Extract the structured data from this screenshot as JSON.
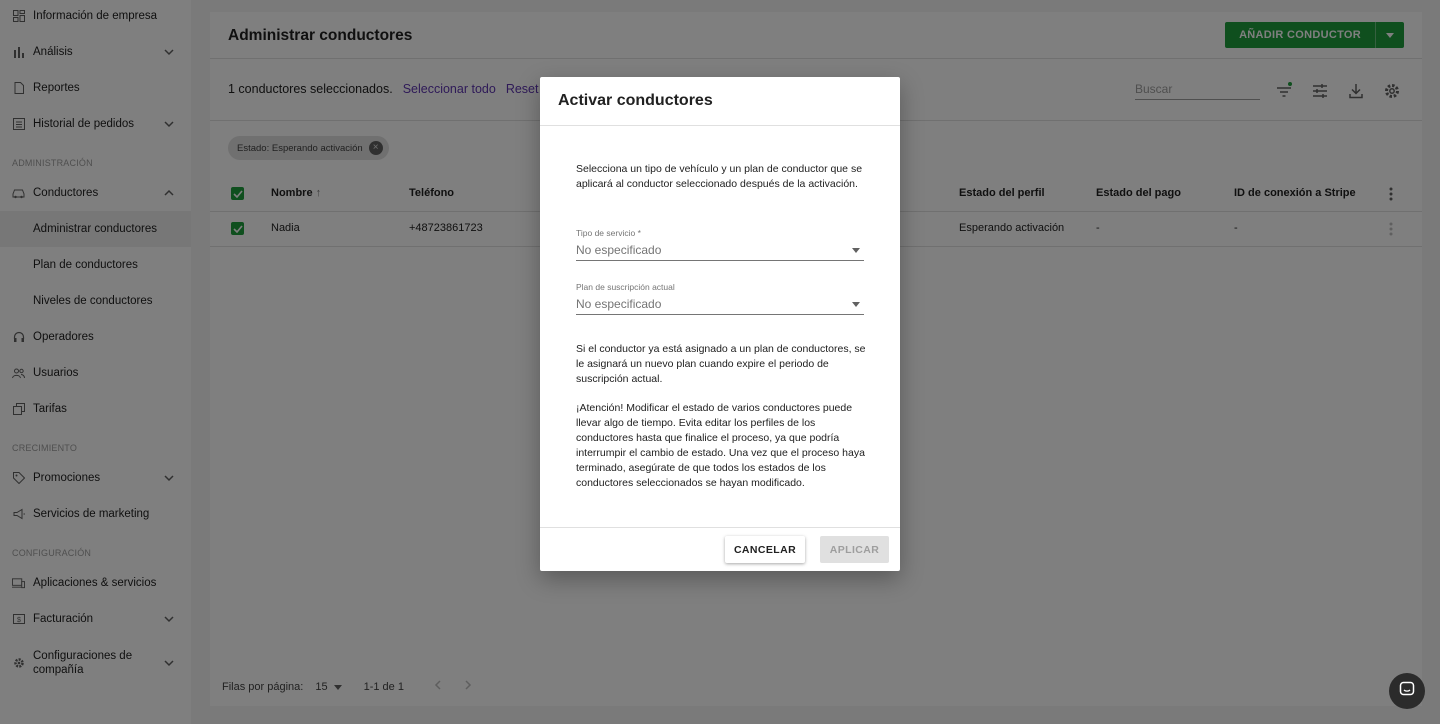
{
  "sidebar": {
    "items": [
      {
        "label": "Información de empresa"
      },
      {
        "label": "Análisis"
      },
      {
        "label": "Reportes"
      },
      {
        "label": "Historial de pedidos"
      },
      {
        "label": "Conductores"
      },
      {
        "label": "Administrar conductores"
      },
      {
        "label": "Plan de conductores"
      },
      {
        "label": "Niveles de conductores"
      },
      {
        "label": "Operadores"
      },
      {
        "label": "Usuarios"
      },
      {
        "label": "Tarifas"
      },
      {
        "label": "Promociones"
      },
      {
        "label": "Servicios de marketing"
      },
      {
        "label": "Aplicaciones & servicios"
      },
      {
        "label": "Facturación"
      },
      {
        "label": "Configuraciones de compañía"
      }
    ],
    "sections": {
      "admin": "ADMINISTRACIÓN",
      "growth": "CRECIMIENTO",
      "config": "CONFIGURACIÓN"
    }
  },
  "main": {
    "title": "Administrar conductores",
    "add_button": "AÑADIR CONDUCTOR",
    "selection_text": "1 conductores seleccionados.",
    "select_all": "Seleccionar todo",
    "reset": "Reset",
    "search_placeholder": "Buscar",
    "filter_chip": "Estado: Esperando activación",
    "columns": {
      "name": "Nombre",
      "phone": "Teléfono",
      "profile_status": "Estado del perfil",
      "payment_status": "Estado del pago",
      "stripe_id": "ID de conexión a Stripe"
    },
    "rows": [
      {
        "name": "Nadia",
        "phone": "+48723861723",
        "profile_status": "Esperando activación",
        "payment_status": "-",
        "stripe_id": "-"
      }
    ],
    "footer": {
      "rows_per_page_label": "Filas por página:",
      "rows_per_page": "15",
      "range": "1-1 de 1"
    }
  },
  "dialog": {
    "title": "Activar conductores",
    "intro": "Selecciona un tipo de vehículo y un plan de conductor que se aplicará al conductor seleccionado después de la activación.",
    "service_type_label": "Tipo de servicio *",
    "service_type_value": "No especificado",
    "plan_label": "Plan de suscripción actual",
    "plan_value": "No especificado",
    "note1": "Si el conductor ya está asignado a un plan de conductores, se le asignará un nuevo plan cuando expire el periodo de suscripción actual.",
    "note2": "¡Atención! Modificar el estado de varios conductores puede llevar algo de tiempo. Evita editar los perfiles de los conductores hasta que finalice el proceso, ya que podría interrumpir el cambio de estado. Una vez que el proceso haya terminado, asegúrate de que todos los estados de los conductores seleccionados se hayan modificado.",
    "cancel": "CANCELAR",
    "apply": "APLICAR"
  },
  "colors": {
    "accent_green": "#1e9e3c",
    "link_purple": "#5e35b1"
  }
}
